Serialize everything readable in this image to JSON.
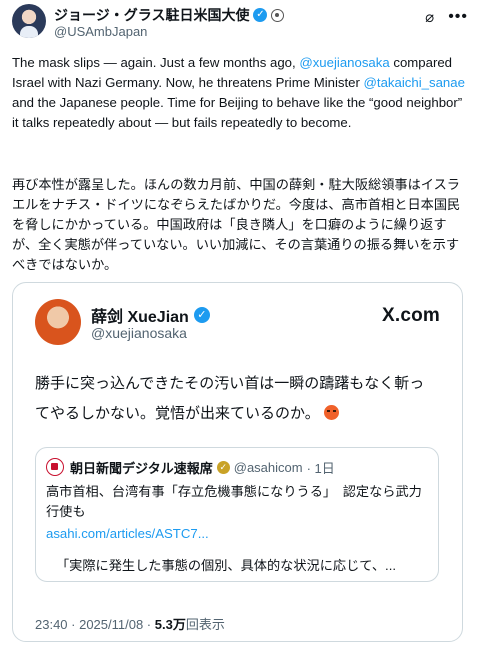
{
  "author": {
    "name": "ジョージ・グラス駐日米国大使",
    "handle": "@USAmbJapan"
  },
  "tweet": {
    "en_seg1": "The mask slips — again. Just a few months ago, ",
    "en_mention1": "@xuejianosaka",
    "en_seg2": " compared Israel with Nazi Germany. Now, he threatens Prime Minister ",
    "en_mention2": "@takaichi_sanae",
    "en_seg3": " and the Japanese people. Time for Beijing to behave like the “good neighbor” it talks repeatedly about — but fails repeatedly to become.",
    "jp_text": "再び本性が露呈した。ほんの数カ月前、中国の薛剣・駐大阪総領事はイスラエルをナチス・ドイツになぞらえたばかりだ。今度は、高市首相と日本国民を脅しにかかっている。中国政府は「良き隣人」を口癖のように繰り返すが、全く実態が伴っていない。いい加減に、その言葉通りの振る舞いを示すべきではないか。"
  },
  "quote": {
    "name": "薛剑 XueJian",
    "handle": "@xuejianosaka",
    "brand": "X.com",
    "text": "勝手に突っ込んできたその汚い首は一瞬の躊躇もなく斬ってやるしかない。覚悟が出来ているのか。",
    "inner": {
      "name": "朝日新聞デジタル速報席",
      "handle": "@asahicom",
      "age": "· 1日",
      "body": "高市首相、台湾有事「存立危機事態になりうる」　認定なら武力行使も",
      "link": "asahi.com/articles/ASTC7...",
      "snippet": "「実際に発生した事態の個別、具体的な状況に応じて、..."
    },
    "timestamp": "23:40 · 2025/11/08 · ",
    "views_count": "5.3万",
    "views_label": "回表示"
  },
  "icons": {
    "edit": "edit-icon",
    "more": "more-icon",
    "verified": "verified-badge-icon",
    "gov": "government-badge-icon",
    "gold": "gold-badge-icon",
    "angry": "angry-face-emoji-icon"
  },
  "colors": {
    "link": "#1d9bf0",
    "secondary_text": "#536471",
    "border": "#cfd9de"
  }
}
